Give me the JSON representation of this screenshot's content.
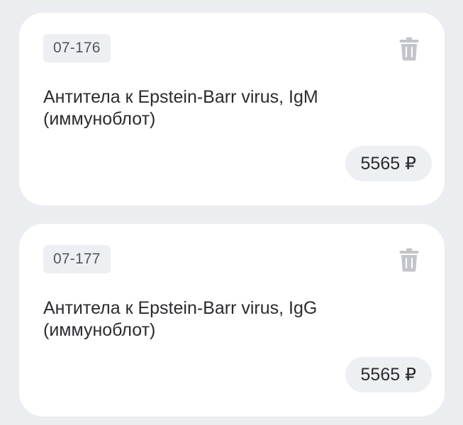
{
  "items": [
    {
      "code": "07-176",
      "title": "Антитела к Epstein-Barr virus, IgM (иммуноблот)",
      "price": "5565 ₽",
      "delete_icon": "trash-icon"
    },
    {
      "code": "07-177",
      "title": "Антитела к Epstein-Barr virus, IgG (иммуноблот)",
      "price": "5565 ₽",
      "delete_icon": "trash-icon"
    }
  ],
  "colors": {
    "page_background": "#ecedf1",
    "card_background": "#ffffff",
    "badge_background": "#eeeff3",
    "icon": "#c4c5ca",
    "text": "#2b2b30"
  }
}
